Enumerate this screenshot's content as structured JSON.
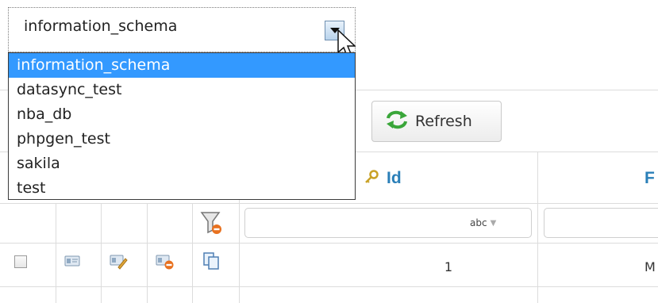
{
  "database_select": {
    "value": "information_schema",
    "options": [
      "information_schema",
      "datasync_test",
      "nba_db",
      "phpgen_test",
      "sakila",
      "test"
    ]
  },
  "toolbar": {
    "refresh_label": "Refresh"
  },
  "grid": {
    "columns": {
      "id_label": "Id",
      "next_label": "F"
    },
    "filter": {
      "type_label": "abc"
    },
    "rows": [
      {
        "id": "1",
        "next": "M"
      }
    ]
  },
  "colors": {
    "accent": "#2a7fb8",
    "selection": "#3399ff"
  },
  "icons": [
    "refresh-icon",
    "key-icon",
    "filter-clear-icon",
    "view-record-icon",
    "edit-record-icon",
    "delete-record-icon",
    "copy-record-icon",
    "dropdown-arrow-icon",
    "cursor-icon"
  ]
}
